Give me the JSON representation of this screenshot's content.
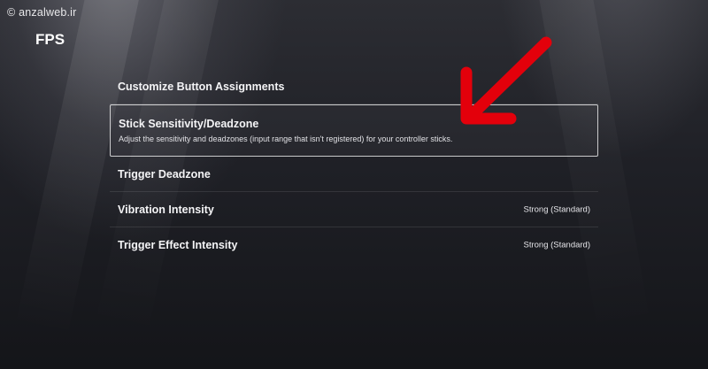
{
  "watermark": {
    "text": "© anzalweb.ir"
  },
  "page_title": "FPS",
  "menu": {
    "items": [
      {
        "label": "Customize Button Assignments"
      },
      {
        "label": "Stick Sensitivity/Deadzone",
        "description": "Adjust the sensitivity and deadzones (input range that isn't registered) for your controller sticks."
      },
      {
        "label": "Trigger Deadzone"
      },
      {
        "label": "Vibration Intensity",
        "value": "Strong (Standard)"
      },
      {
        "label": "Trigger Effect Intensity",
        "value": "Strong (Standard)"
      }
    ]
  },
  "annotation": {
    "icon": "arrow-icon",
    "color": "#e3000b"
  }
}
